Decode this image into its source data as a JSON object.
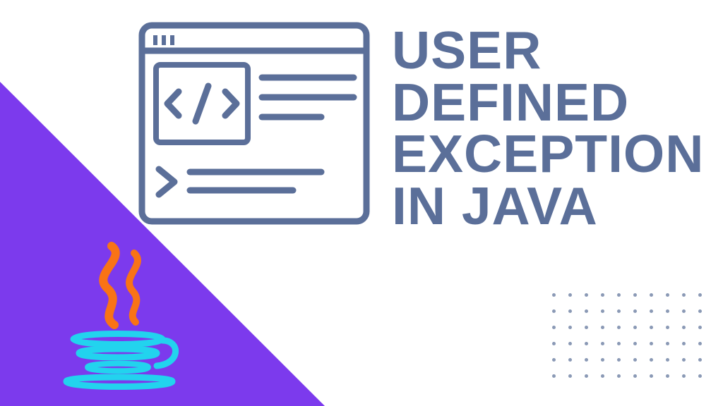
{
  "headline": {
    "line1": "USER",
    "line2": "DEFINED",
    "line3": "EXCEPTION",
    "line4": "IN JAVA"
  },
  "colors": {
    "triangle": "#7c3aed",
    "headline": "#5b6f99",
    "windowStroke": "#5b6f99",
    "javaSteam": "#f97316",
    "javaCup": "#22d3ee",
    "dot": "#8a99b5"
  },
  "dotGrid": {
    "rows": 6,
    "cols": 10
  }
}
